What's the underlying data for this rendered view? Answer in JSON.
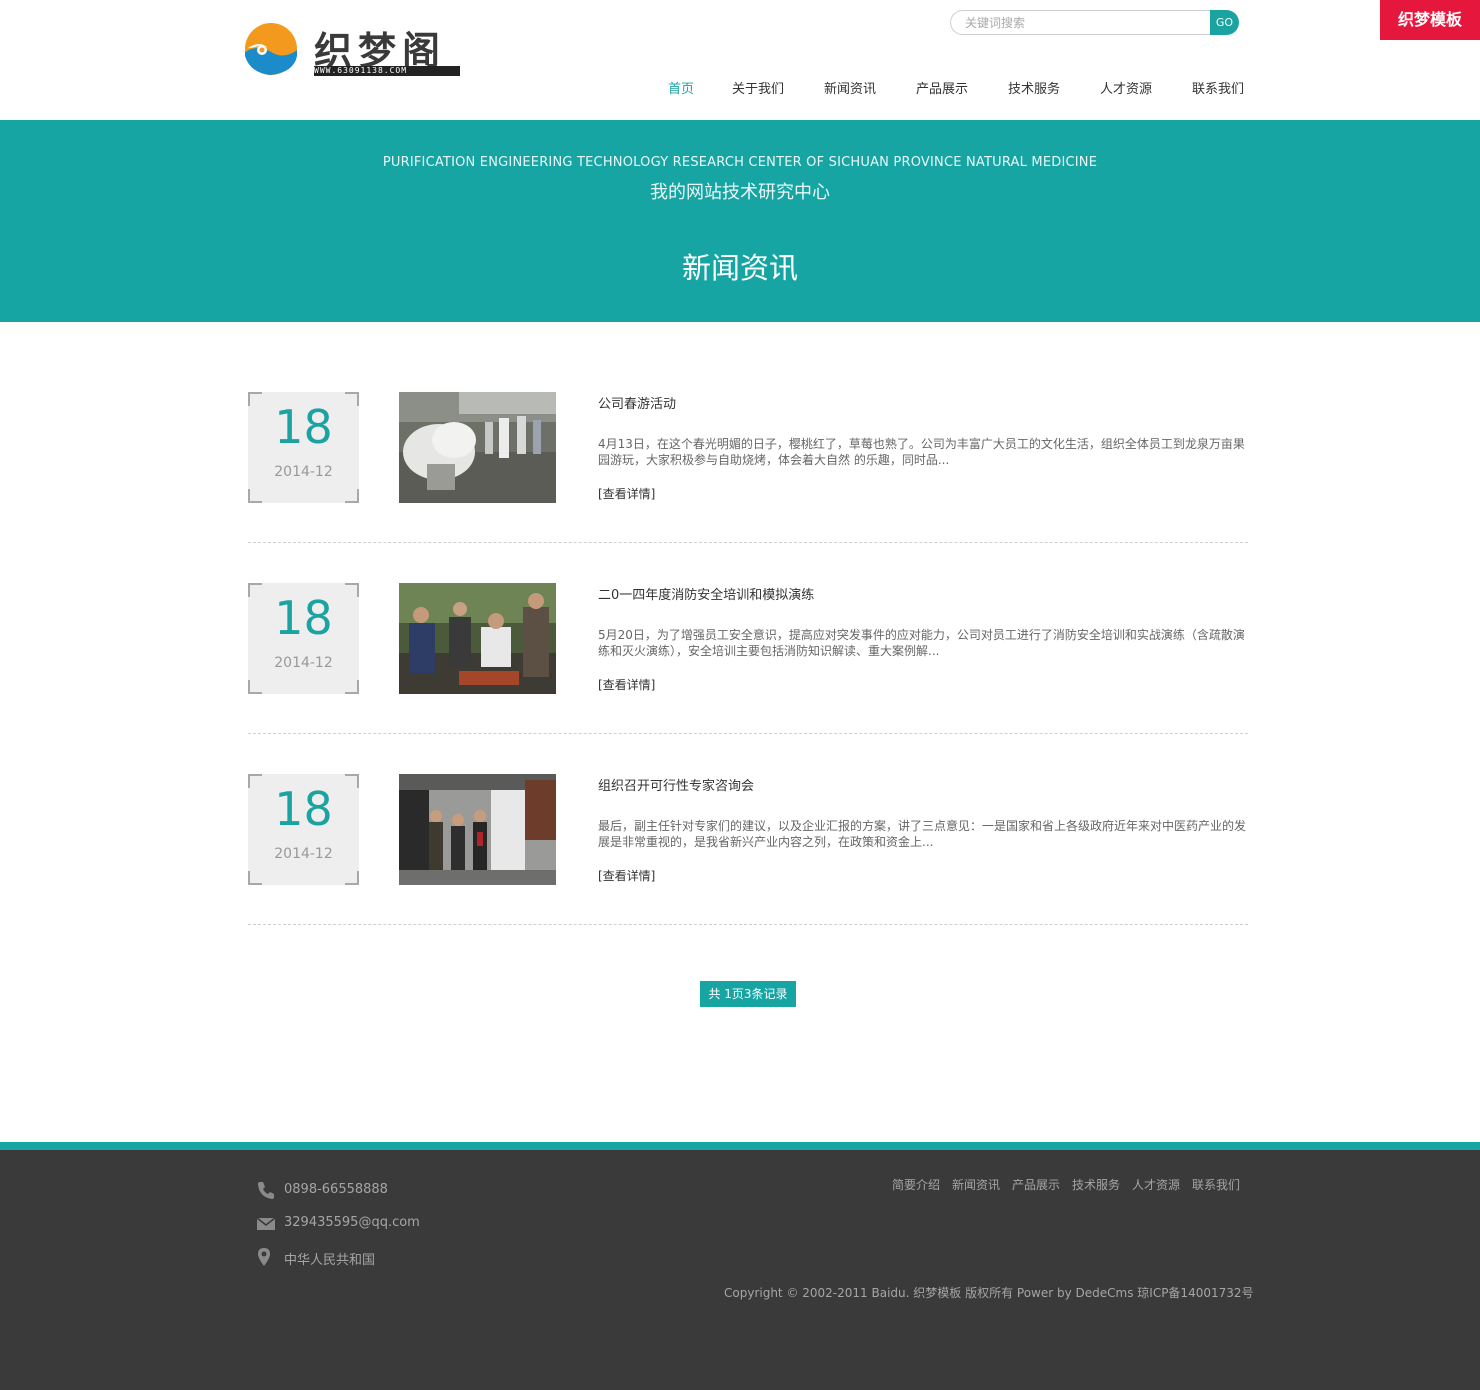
{
  "header": {
    "logo_title": "织梦阁",
    "logo_url": "WWW.63091138.COM",
    "search_placeholder": "关键词搜索",
    "search_button": "GO",
    "corner_badge": "织梦模板",
    "nav": [
      {
        "label": "首页",
        "active": true
      },
      {
        "label": "关于我们",
        "active": false
      },
      {
        "label": "新闻资讯",
        "active": false
      },
      {
        "label": "产品展示",
        "active": false
      },
      {
        "label": "技术服务",
        "active": false
      },
      {
        "label": "人才资源",
        "active": false
      },
      {
        "label": "联系我们",
        "active": false
      }
    ]
  },
  "banner": {
    "english": "PURIFICATION ENGINEERING TECHNOLOGY RESEARCH CENTER OF SICHUAN PROVINCE NATURAL MEDICINE",
    "chinese": "我的网站技术研究中心",
    "title": "新闻资讯"
  },
  "news": [
    {
      "day": "18",
      "year_month": "2014-12",
      "title": "公司春游活动",
      "summary": "4月13日，在这个春光明媚的日子，樱桃红了，草莓也熟了。公司为丰富广大员工的文化生活，组织全体员工到龙泉万亩果园游玩，大家积极参与自助烧烤，体会着大自然 的乐趣，同时品...",
      "more": "[查看详情]"
    },
    {
      "day": "18",
      "year_month": "2014-12",
      "title": "二0一四年度消防安全培训和模拟演练",
      "summary": "5月20日，为了增强员工安全意识，提高应对突发事件的应对能力，公司对员工进行了消防安全培训和实战演练（含疏散演练和灭火演练），安全培训主要包括消防知识解读、重大案例解...",
      "more": "[查看详情]"
    },
    {
      "day": "18",
      "year_month": "2014-12",
      "title": "组织召开可行性专家咨询会",
      "summary": "最后，副主任针对专家们的建议，以及企业汇报的方案，讲了三点意见：一是国家和省上各级政府近年来对中医药产业的发展是非常重视的，是我省新兴产业内容之列，在政策和资金上...",
      "more": "[查看详情]"
    }
  ],
  "pager": "共 1页3条记录",
  "footer": {
    "phone": "0898-66558888",
    "email": "329435595@qq.com",
    "address": "中华人民共和国",
    "links": [
      "简要介绍",
      "新闻资讯",
      "产品展示",
      "技术服务",
      "人才资源",
      "联系我们"
    ],
    "copyright": "Copyright © 2002-2011 Baidu. 织梦模板 版权所有 Power by DedeCms   琼ICP备14001732号"
  },
  "colors": {
    "accent": "#17a5a3",
    "badge": "#e6173d",
    "footer_bg": "#3a3a3a"
  }
}
